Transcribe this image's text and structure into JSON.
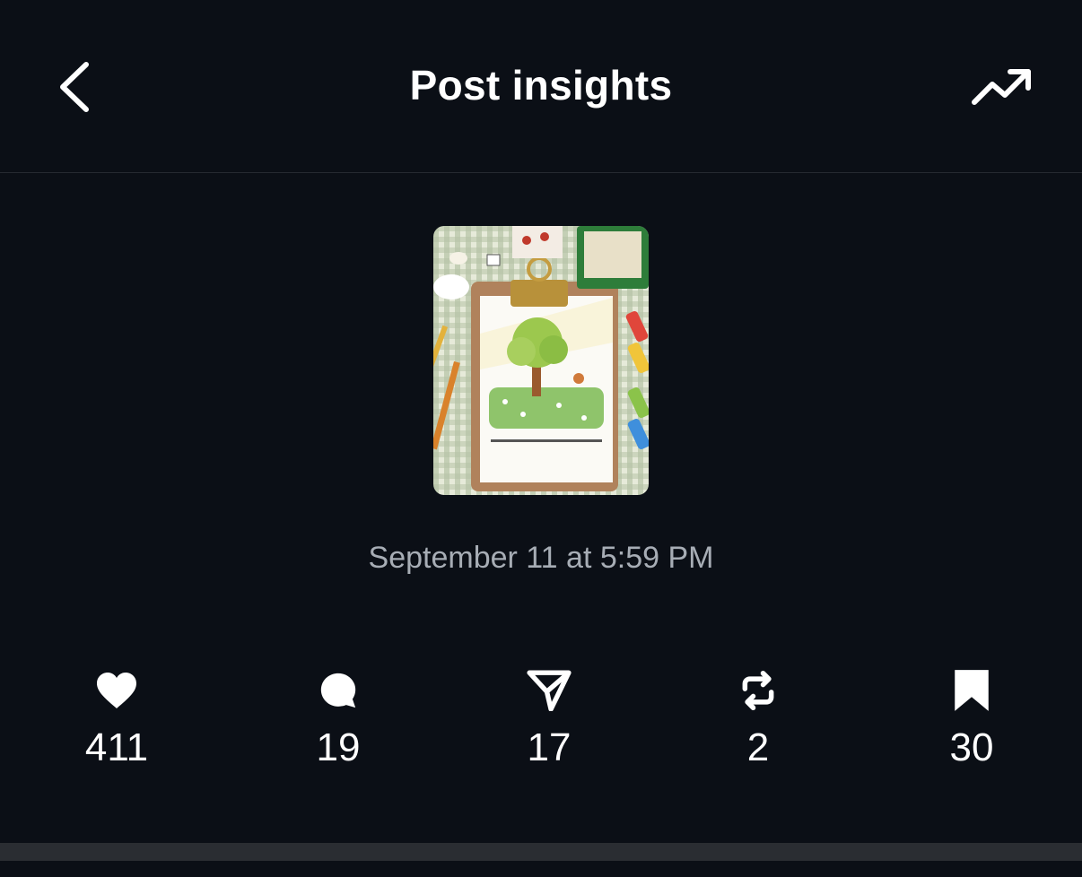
{
  "header": {
    "title": "Post insights",
    "back_icon": "chevron-left-icon",
    "trend_icon": "trending-up-icon"
  },
  "post": {
    "thumbnail": "clipboard-tree-painting",
    "timestamp": "September 11 at 5:59 PM"
  },
  "stats": [
    {
      "name": "likes",
      "icon": "heart-icon",
      "value": "411"
    },
    {
      "name": "comments",
      "icon": "comment-icon",
      "value": "19"
    },
    {
      "name": "shares",
      "icon": "send-icon",
      "value": "17"
    },
    {
      "name": "reposts",
      "icon": "repost-icon",
      "value": "2"
    },
    {
      "name": "saves",
      "icon": "bookmark-icon",
      "value": "30"
    }
  ],
  "colors": {
    "background": "#0b0f16",
    "text": "#ffffff",
    "secondary_text": "#a7adb5",
    "divider": "#262a31"
  }
}
